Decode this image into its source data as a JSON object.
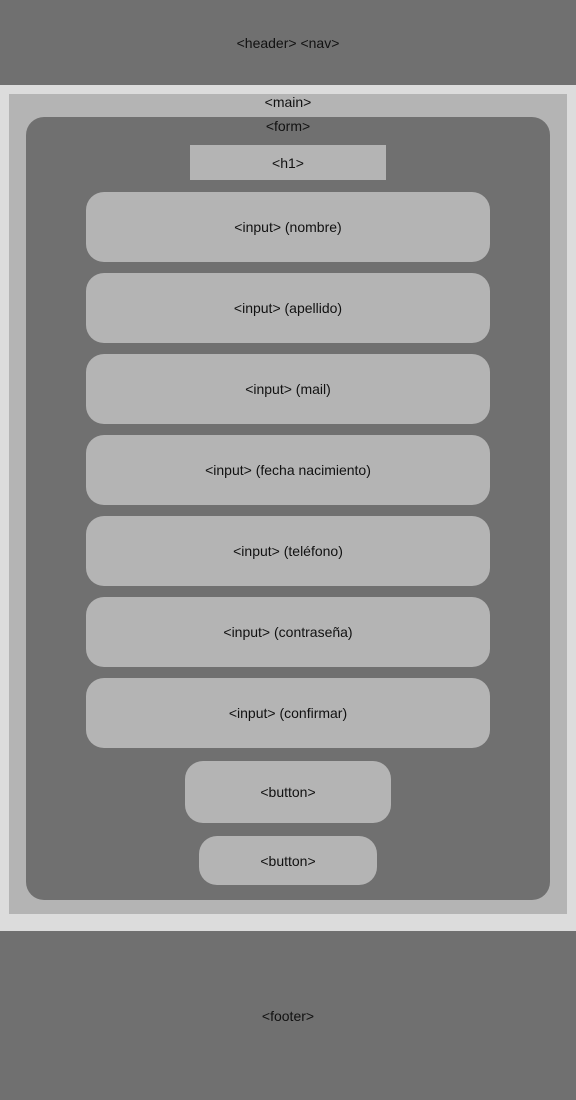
{
  "header": {
    "label": "<header> <nav>"
  },
  "main": {
    "label": "<main>"
  },
  "form": {
    "label": "<form>",
    "heading": "<h1>",
    "inputs": [
      "<input> (nombre)",
      "<input> (apellido)",
      "<input> (mail)",
      "<input> (fecha nacimiento)",
      "<input> (teléfono)",
      "<input> (contraseña)",
      "<input> (confirmar)"
    ],
    "buttons": [
      "<button>",
      "<button>"
    ]
  },
  "footer": {
    "label": "<footer>"
  },
  "colors": {
    "dark_block": "#707070",
    "light_block": "#b4b4b4",
    "background": "#dcdcdc"
  }
}
